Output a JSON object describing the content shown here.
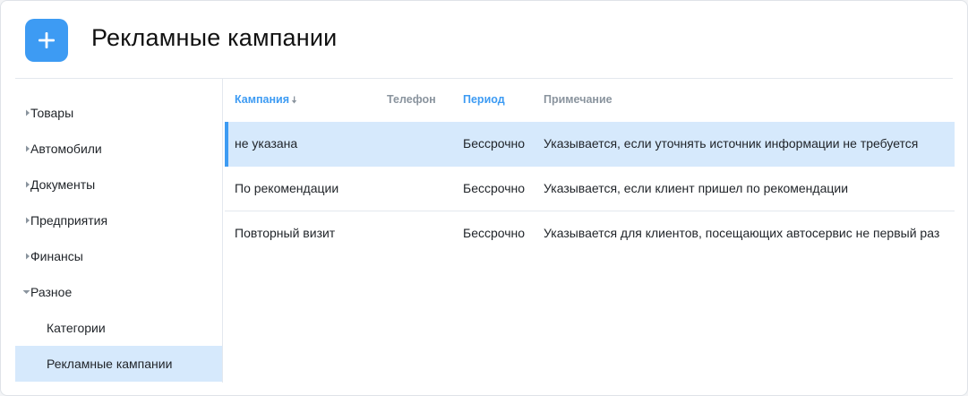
{
  "header": {
    "title": "Рекламные кампании",
    "add_icon": "plus-icon"
  },
  "colors": {
    "accent": "#3d9bf3",
    "selected_bg": "#d6e9fc",
    "header_gray": "#8a949e"
  },
  "sidebar": {
    "items": [
      {
        "label": "Товары",
        "icon": "chevron-right-icon"
      },
      {
        "label": "Автомобили",
        "icon": "chevron-right-icon"
      },
      {
        "label": "Документы",
        "icon": "chevron-right-icon"
      },
      {
        "label": "Предприятия",
        "icon": "chevron-right-icon"
      },
      {
        "label": "Финансы",
        "icon": "chevron-right-icon"
      },
      {
        "label": "Разное",
        "icon": "chevron-down-icon"
      },
      {
        "label": "Категории"
      },
      {
        "label": "Рекламные кампании",
        "active": true
      }
    ]
  },
  "table": {
    "columns": [
      {
        "label": "Кампания",
        "sort": "desc"
      },
      {
        "label": "Телефон"
      },
      {
        "label": "Период"
      },
      {
        "label": "Примечание"
      }
    ],
    "rows": [
      {
        "campaign": "не указана",
        "phone": "",
        "period": "Бессрочно",
        "note": "Указывается, если уточнять источник информации не требуется",
        "selected": true
      },
      {
        "campaign": "По рекомендации",
        "phone": "",
        "period": "Бессрочно",
        "note": "Указывается, если клиент пришел по рекомендации"
      },
      {
        "campaign": "Повторный визит",
        "phone": "",
        "period": "Бессрочно",
        "note": "Указывается для клиентов, посещающих автосервис не первый раз"
      }
    ]
  }
}
